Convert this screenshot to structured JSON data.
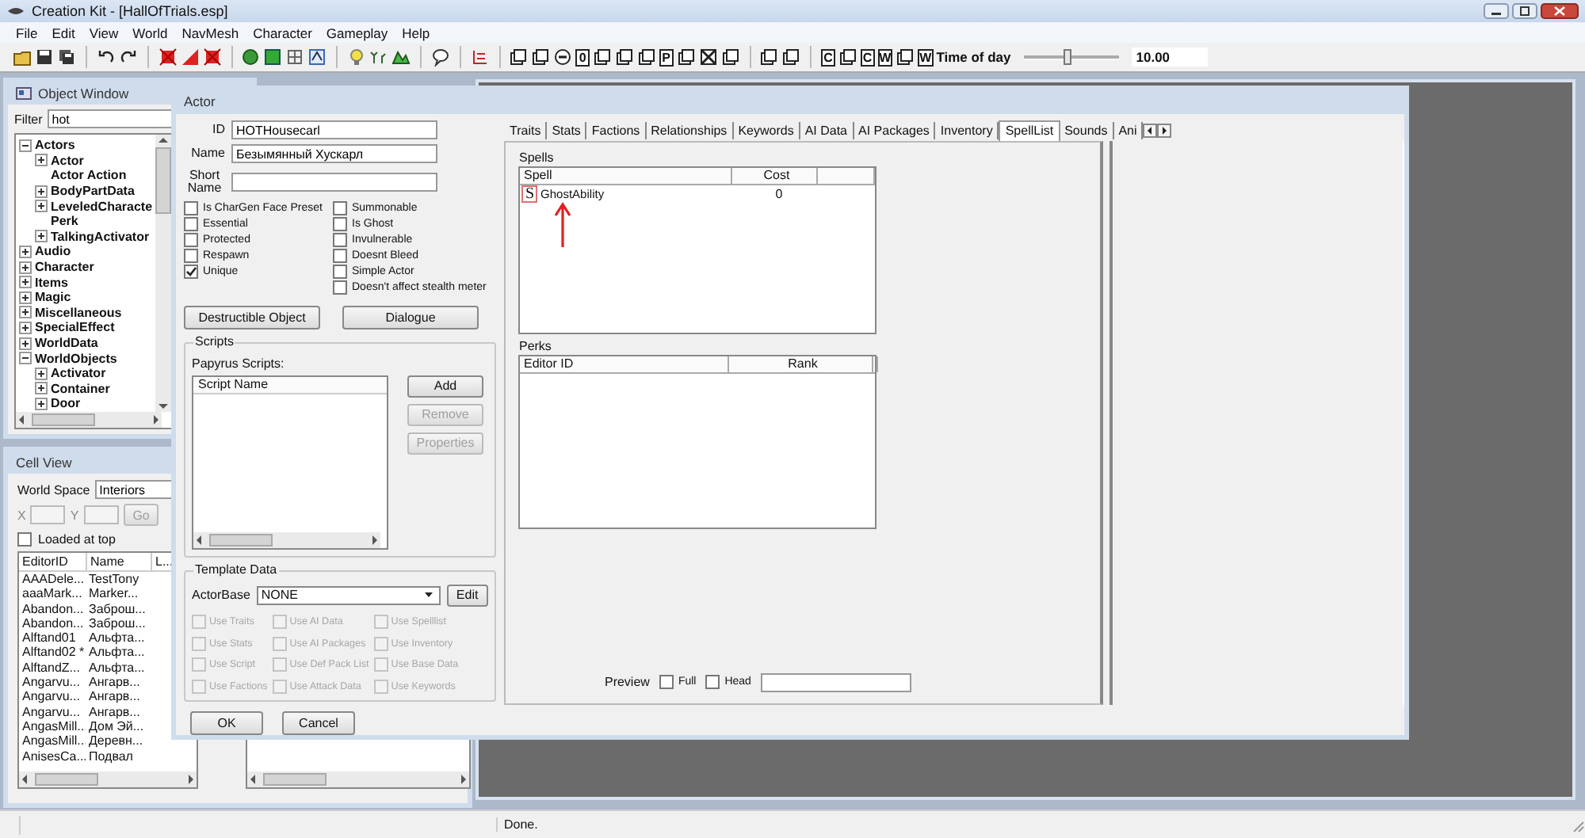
{
  "window": {
    "title": "Creation Kit - [HallOfTrials.esp]"
  },
  "menu": [
    "File",
    "Edit",
    "View",
    "World",
    "NavMesh",
    "Character",
    "Gameplay",
    "Help"
  ],
  "toolbar": {
    "glyphs": [
      "0",
      "P",
      "C",
      "C",
      "W",
      "W"
    ]
  },
  "time_of_day": {
    "label": "Time of day",
    "level": 0.45,
    "value": "10.00"
  },
  "object_window": {
    "title": "Object Window",
    "filter_label": "Filter",
    "filter_value": "hot",
    "tree": [
      {
        "label": "Actors",
        "kind": "group",
        "expanded": true,
        "children": [
          {
            "label": "Actor",
            "kind": "group",
            "expanded": false
          },
          {
            "label": "Actor Action",
            "kind": "leaf"
          },
          {
            "label": "BodyPartData",
            "kind": "group",
            "expanded": false
          },
          {
            "label": "LeveledCharacte",
            "kind": "group",
            "expanded": false
          },
          {
            "label": "Perk",
            "kind": "leaf"
          },
          {
            "label": "TalkingActivator",
            "kind": "group",
            "expanded": false
          }
        ]
      },
      {
        "label": "Audio",
        "kind": "group",
        "expanded": false
      },
      {
        "label": "Character",
        "kind": "group",
        "expanded": false
      },
      {
        "label": "Items",
        "kind": "group",
        "expanded": false
      },
      {
        "label": "Magic",
        "kind": "group",
        "expanded": false
      },
      {
        "label": "Miscellaneous",
        "kind": "group",
        "expanded": false
      },
      {
        "label": "SpecialEffect",
        "kind": "group",
        "expanded": false
      },
      {
        "label": "WorldData",
        "kind": "group",
        "expanded": false
      },
      {
        "label": "WorldObjects",
        "kind": "group",
        "expanded": true,
        "children": [
          {
            "label": "Activator",
            "kind": "group",
            "expanded": false
          },
          {
            "label": "Container",
            "kind": "group",
            "expanded": false
          },
          {
            "label": "Door",
            "kind": "group",
            "expanded": false
          }
        ]
      }
    ]
  },
  "cell_view": {
    "title": "Cell View",
    "world_space_label": "World Space",
    "world_space_value": "Interiors",
    "x_label": "X",
    "y_label": "Y",
    "go_button": {
      "label": "Go",
      "disabled": true
    },
    "loaded_at_top": {
      "label": "Loaded at top",
      "checked": false
    },
    "columns": [
      "EditorID",
      "Name",
      "L..."
    ],
    "rows": [
      [
        "AAADele...",
        "TestTony"
      ],
      [
        "aaaMark...",
        "Marker..."
      ],
      [
        "Abandon...",
        "Заброш..."
      ],
      [
        "Abandon...",
        "Заброш..."
      ],
      [
        "Alftand01",
        "Альфта..."
      ],
      [
        "Alftand02 *",
        "Альфта..."
      ],
      [
        "AlftandZ...",
        "Альфта..."
      ],
      [
        "Angarvu...",
        "Ангарв..."
      ],
      [
        "Angarvu...",
        "Ангарв..."
      ],
      [
        "Angarvu...",
        "Ангарв..."
      ],
      [
        "AngasMill...",
        "Дом Эй..."
      ],
      [
        "AngasMill...",
        "Деревн..."
      ],
      [
        "AnisesCa...",
        "Подвал"
      ]
    ]
  },
  "actor": {
    "title": "Actor",
    "id_label": "ID",
    "id_value": "HOTHousecarl",
    "name_label": "Name",
    "name_value": "Безымянный Хускарл",
    "short_name_label": "Short Name",
    "flags_left": [
      {
        "label": "Is CharGen Face Preset",
        "checked": false
      },
      {
        "label": "Essential",
        "checked": false
      },
      {
        "label": "Protected",
        "checked": false
      },
      {
        "label": "Respawn",
        "checked": false
      },
      {
        "label": "Unique",
        "checked": true
      }
    ],
    "flags_right": [
      {
        "label": "Summonable",
        "checked": false
      },
      {
        "label": "Is Ghost",
        "checked": false
      },
      {
        "label": "Invulnerable",
        "checked": false
      },
      {
        "label": "Doesnt Bleed",
        "checked": false
      },
      {
        "label": "Simple Actor",
        "checked": false
      },
      {
        "label": "Doesn't affect stealth meter",
        "checked": false
      }
    ],
    "buttons": [
      "Destructible Object",
      "Dialogue"
    ],
    "scripts": {
      "title": "Scripts",
      "label": "Papyrus Scripts:",
      "column": "Script Name",
      "buttons": [
        {
          "label": "Add",
          "disabled": false
        },
        {
          "label": "Remove",
          "disabled": true
        },
        {
          "label": "Properties",
          "disabled": true
        }
      ]
    },
    "template": {
      "title": "Template Data",
      "base_label": "ActorBase",
      "base_value": "NONE",
      "edit_button": "Edit",
      "flags": [
        {
          "label": "Use Traits",
          "checked": false,
          "disabled": true
        },
        {
          "label": "Use AI Data",
          "checked": false,
          "disabled": true
        },
        {
          "label": "Use Spelllist",
          "checked": false,
          "disabled": true
        },
        {
          "label": "Use Stats",
          "checked": false,
          "disabled": true
        },
        {
          "label": "Use AI Packages",
          "checked": false,
          "disabled": true
        },
        {
          "label": "Use Inventory",
          "checked": false,
          "disabled": true
        },
        {
          "label": "Use Script",
          "checked": false,
          "disabled": true
        },
        {
          "label": "Use Def Pack List",
          "checked": false,
          "disabled": true
        },
        {
          "label": "Use Base Data",
          "checked": false,
          "disabled": true
        },
        {
          "label": "Use Factions",
          "checked": false,
          "disabled": true
        },
        {
          "label": "Use Attack Data",
          "checked": false,
          "disabled": true
        },
        {
          "label": "Use Keywords",
          "checked": false,
          "disabled": true
        }
      ]
    },
    "tabs": [
      {
        "label": "Traits",
        "selected": false
      },
      {
        "label": "Stats",
        "selected": false
      },
      {
        "label": "Factions",
        "selected": false
      },
      {
        "label": "Relationships",
        "selected": false
      },
      {
        "label": "Keywords",
        "selected": false
      },
      {
        "label": "AI Data",
        "selected": false
      },
      {
        "label": "AI Packages",
        "selected": false
      },
      {
        "label": "Inventory",
        "selected": false
      },
      {
        "label": "SpellList",
        "selected": true
      },
      {
        "label": "Sounds",
        "selected": false
      },
      {
        "label": "Ani",
        "selected": false
      }
    ],
    "spells": {
      "title": "Spells",
      "columns": [
        "Spell",
        "Cost"
      ],
      "rows": [
        {
          "badge": "S",
          "name": "GhostAbility",
          "cost": "0"
        }
      ]
    },
    "perks": {
      "title": "Perks",
      "columns": [
        "Editor ID",
        "Rank"
      ]
    },
    "preview": {
      "label": "Preview",
      "full": {
        "label": "Full",
        "checked": false
      },
      "head": {
        "label": "Head",
        "checked": false
      }
    },
    "footer_buttons": [
      "OK",
      "Cancel"
    ]
  },
  "status_bar": {
    "text": "Done."
  }
}
